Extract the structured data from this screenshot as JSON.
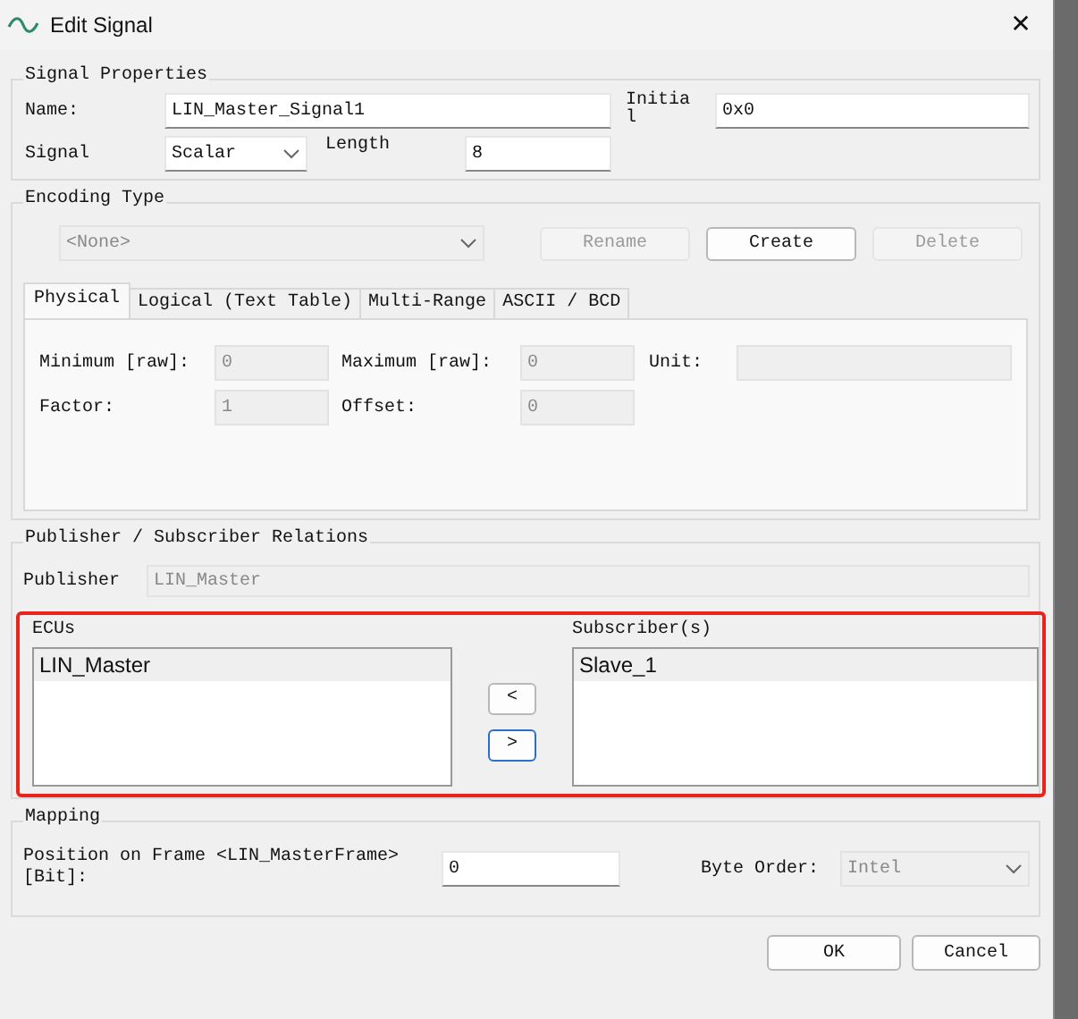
{
  "window": {
    "title": "Edit Signal",
    "close": "✕"
  },
  "signal_properties": {
    "legend": "Signal Properties",
    "name": {
      "label": "Name:",
      "value": "LIN_Master_Signal1"
    },
    "initial": {
      "label": "Initia\nl",
      "value": "0x0"
    },
    "signal": {
      "label": "Signal",
      "value": "Scalar"
    },
    "length": {
      "label": "Length",
      "value": "8"
    }
  },
  "encoding_type": {
    "legend": "Encoding Type",
    "select": {
      "value": "<None>",
      "disabled": true
    },
    "buttons": [
      {
        "label": "Rename",
        "disabled": true
      },
      {
        "label": "Create",
        "disabled": false
      },
      {
        "label": "Delete",
        "disabled": true
      }
    ],
    "tabs": [
      {
        "label": "Physical",
        "selected": true
      },
      {
        "label": "Logical (Text Table)",
        "selected": false
      },
      {
        "label": "Multi-Range",
        "selected": false
      },
      {
        "label": "ASCII / BCD",
        "selected": false
      }
    ],
    "fields": [
      {
        "label": "Minimum [raw]:",
        "value": "0",
        "disabled": true
      },
      {
        "label": "Maximum [raw]:",
        "value": "0",
        "disabled": true
      },
      {
        "label": "Unit:",
        "disabled": true
      },
      {
        "label": "Factor:",
        "value": "1",
        "disabled": true
      },
      {
        "label": "Offset:",
        "value": "0",
        "disabled": true
      }
    ]
  },
  "relations": {
    "legend": "Publisher / Subscriber Relations",
    "publisher": {
      "label": "Publisher",
      "value": "LIN_Master",
      "disabled": true
    },
    "highlighted": true,
    "ecus": {
      "label": "ECUs",
      "items": [
        {
          "label": "LIN_Master",
          "selected": true
        }
      ]
    },
    "move_buttons": [
      {
        "label": "<",
        "focused": false
      },
      {
        "label": ">",
        "focused": true
      }
    ],
    "subscribers": {
      "label": "Subscriber(s)",
      "items": [
        {
          "label": "Slave_1",
          "selected": true
        }
      ]
    }
  },
  "mapping": {
    "legend": "Mapping",
    "position": {
      "label": "Position on Frame <LIN_MasterFrame>\n[Bit]:",
      "value": "0"
    },
    "byte_order": {
      "label": "Byte Order:",
      "value": "Intel",
      "disabled": true
    }
  },
  "buttons": [
    "OK",
    "Cancel"
  ]
}
